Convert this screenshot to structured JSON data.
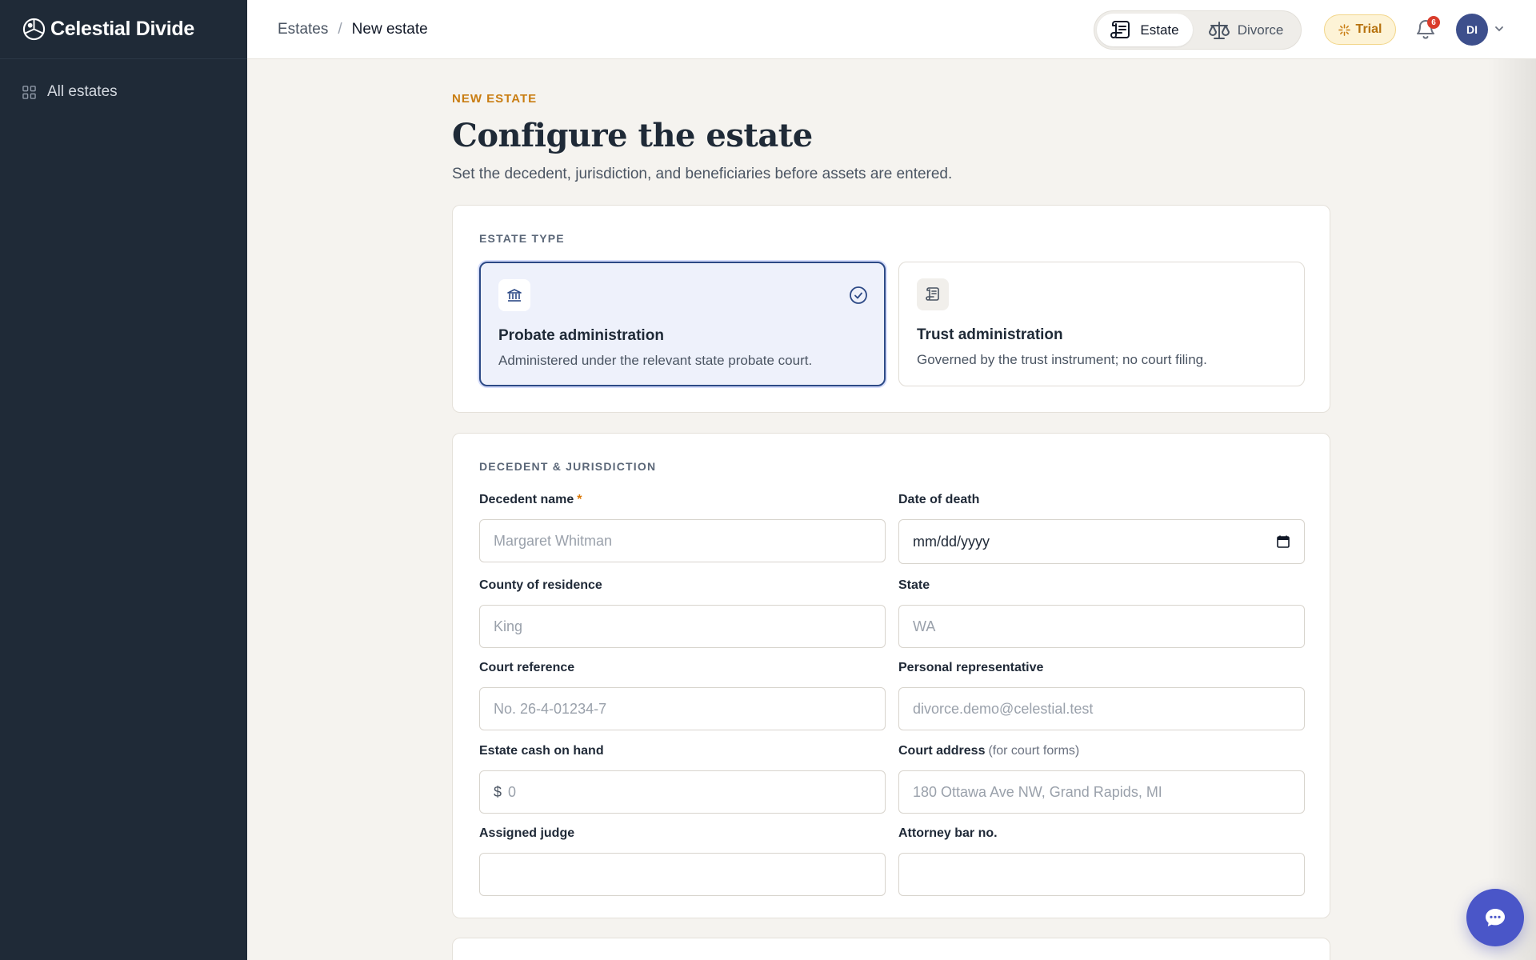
{
  "app": {
    "name": "Celestial Divide"
  },
  "sidebar": {
    "items": [
      {
        "label": "All estates",
        "icon": "grid-icon"
      }
    ]
  },
  "breadcrumb": {
    "parent": "Estates",
    "separator": "/",
    "current": "New estate"
  },
  "mode_switch": {
    "estate_label": "Estate",
    "divorce_label": "Divorce",
    "active": "Estate"
  },
  "trial": {
    "label": "Trial"
  },
  "notifications": {
    "count": "6"
  },
  "user": {
    "initials": "DI"
  },
  "page": {
    "eyebrow": "NEW ESTATE",
    "title": "Configure the estate",
    "subtitle": "Set the decedent, jurisdiction, and beneficiaries before assets are entered."
  },
  "estate_type": {
    "section_title": "ESTATE TYPE",
    "options": [
      {
        "title": "Probate administration",
        "description": "Administered under the relevant state probate court.",
        "selected": true,
        "icon": "courthouse-icon"
      },
      {
        "title": "Trust administration",
        "description": "Governed by the trust instrument; no court filing.",
        "selected": false,
        "icon": "scroll-icon"
      }
    ]
  },
  "decedent": {
    "section_title": "DECEDENT & JURISDICTION",
    "fields": {
      "decedent_name": {
        "label": "Decedent name",
        "required_mark": "*",
        "placeholder": "Margaret Whitman",
        "value": ""
      },
      "date_of_death": {
        "label": "Date of death",
        "value": "mm/dd/yyyy"
      },
      "county": {
        "label": "County of residence",
        "placeholder": "King",
        "value": ""
      },
      "state": {
        "label": "State",
        "placeholder": "WA",
        "value": ""
      },
      "court_reference": {
        "label": "Court reference",
        "placeholder": "No. 26-4-01234-7",
        "value": ""
      },
      "personal_rep": {
        "label": "Personal representative",
        "placeholder": "divorce.demo@celestial.test",
        "value": ""
      },
      "cash_on_hand": {
        "label": "Estate cash on hand",
        "prefix": "$",
        "placeholder": "0",
        "value": ""
      },
      "court_address": {
        "label": "Court address",
        "hint": "(for court forms)",
        "placeholder": "180 Ottawa Ave NW, Grand Rapids, MI",
        "value": ""
      },
      "assigned_judge": {
        "label": "Assigned judge",
        "placeholder": "",
        "value": ""
      },
      "attorney_bar": {
        "label": "Attorney bar no.",
        "placeholder": "",
        "value": ""
      }
    }
  },
  "colors": {
    "sidebar_bg": "#1f2a37",
    "accent": "#2d4a86",
    "eyebrow": "#c97d12",
    "chat_fab": "#4a56c8"
  }
}
